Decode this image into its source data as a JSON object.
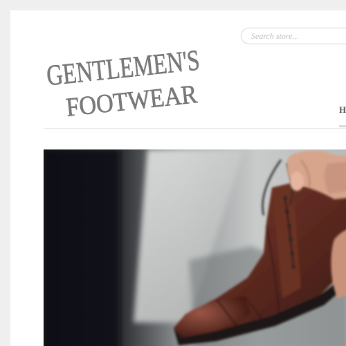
{
  "brand": {
    "logo_line1": "GENTLEMEN'S",
    "logo_line2": "FOOTWEAR"
  },
  "search": {
    "placeholder": "Search store..."
  },
  "nav": {
    "items": [
      {
        "label": "H"
      }
    ]
  },
  "hero": {
    "subject": "brown leather cap-toe boot being laced"
  }
}
